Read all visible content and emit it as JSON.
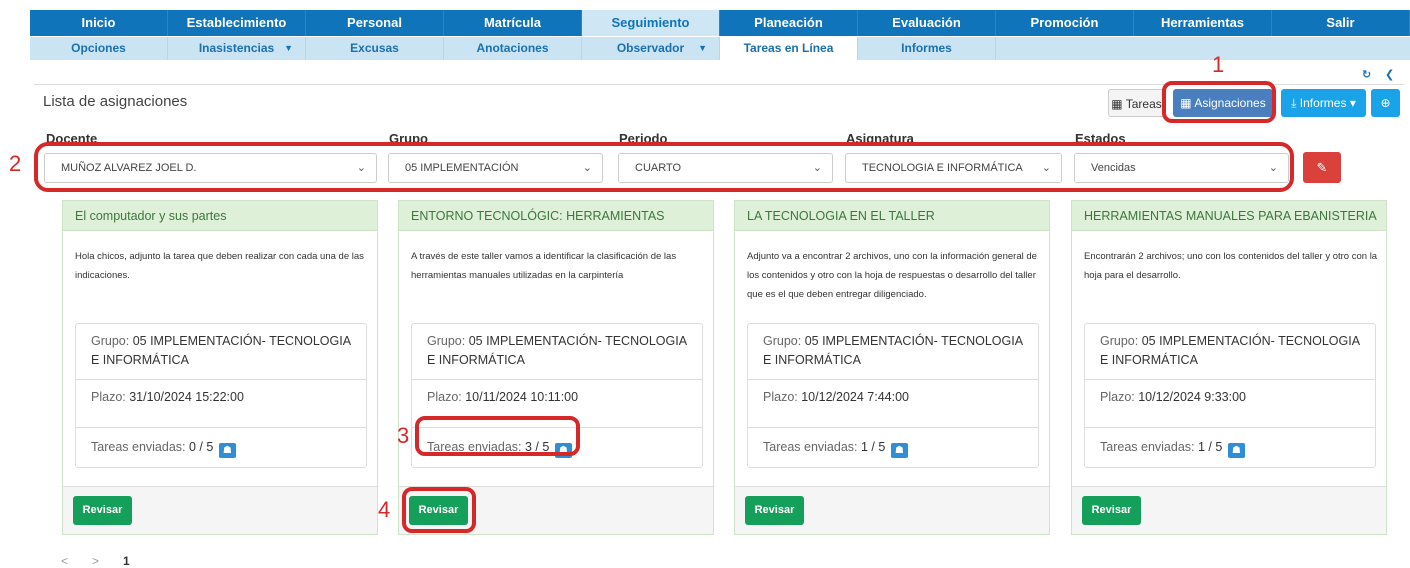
{
  "nav_main": [
    "Inicio",
    "Establecimiento",
    "Personal",
    "Matrícula",
    "Seguimiento",
    "Planeación",
    "Evaluación",
    "Promoción",
    "Herramientas",
    "Salir"
  ],
  "nav_sub": [
    {
      "label": "Opciones",
      "caret": ""
    },
    {
      "label": "Inasistencias",
      "caret": "▼"
    },
    {
      "label": "Excusas",
      "caret": ""
    },
    {
      "label": "Anotaciones",
      "caret": ""
    },
    {
      "label": "Observador",
      "caret": "▼"
    },
    {
      "label": "Tareas en Línea",
      "caret": ""
    },
    {
      "label": "Informes",
      "caret": ""
    }
  ],
  "page": {
    "title": "Lista de asignaciones"
  },
  "toolbar": {
    "tareas": "Tareas",
    "asignaciones": "Asignaciones",
    "informes": "Informes",
    "refresh_icon": "↻",
    "nav_icon": "❮"
  },
  "filters": {
    "docente_label": "Docente",
    "docente_value": "MUÑOZ ALVAREZ JOEL D.",
    "grupo_label": "Grupo",
    "grupo_value": "05 IMPLEMENTACIÓN",
    "periodo_label": "Periodo",
    "periodo_value": "CUARTO",
    "asignatura_label": "Asignatura",
    "asignatura_value": "TECNOLOGIA E INFORMÁTICA",
    "estados_label": "Estados",
    "estados_value": "Vencidas"
  },
  "cards": [
    {
      "title": "El computador y sus partes",
      "desc": "Hola chicos, adjunto la tarea que deben realizar con cada una de las indicaciones.",
      "grupo_label": "Grupo:",
      "grupo": "05 IMPLEMENTACIÓN- TECNOLOGIA E INFORMÁTICA",
      "plazo_label": "Plazo:",
      "plazo": "31/10/2024 15:22:00",
      "enviadas_label": "Tareas enviadas:",
      "enviadas": "0 / 5",
      "button": "Revisar"
    },
    {
      "title": "ENTORNO TECNOLÓGIC: HERRAMIENTAS",
      "desc": "A través de este taller vamos a identificar la clasificación de las herramientas manuales utilizadas en la carpintería",
      "grupo_label": "Grupo:",
      "grupo": "05 IMPLEMENTACIÓN- TECNOLOGIA E INFORMÁTICA",
      "plazo_label": "Plazo:",
      "plazo": "10/11/2024 10:11:00",
      "enviadas_label": "Tareas enviadas:",
      "enviadas": "3 / 5",
      "button": "Revisar"
    },
    {
      "title": "LA TECNOLOGIA EN EL TALLER",
      "desc": "Adjunto va a encontrar 2 archivos, uno con la información general de los contenidos y otro con la hoja de respuestas o desarrollo del taller que es el que deben entregar diligenciado.",
      "grupo_label": "Grupo:",
      "grupo": "05 IMPLEMENTACIÓN- TECNOLOGIA E INFORMÁTICA",
      "plazo_label": "Plazo:",
      "plazo": "10/12/2024 7:44:00",
      "enviadas_label": "Tareas enviadas:",
      "enviadas": "1 / 5",
      "button": "Revisar"
    },
    {
      "title": "HERRAMIENTAS MANUALES PARA EBANISTERIA",
      "desc": "Encontrarán 2 archivos; uno con los contenidos del taller y otro con la hoja para el desarrollo.",
      "grupo_label": "Grupo:",
      "grupo": "05 IMPLEMENTACIÓN- TECNOLOGIA E INFORMÁTICA",
      "plazo_label": "Plazo:",
      "plazo": "10/12/2024 9:33:00",
      "enviadas_label": "Tareas enviadas:",
      "enviadas": "1 / 5",
      "button": "Revisar"
    }
  ],
  "annotations": [
    "1",
    "2",
    "3",
    "4"
  ],
  "pager": {
    "prev": "<",
    "next": ">",
    "current": "1"
  },
  "colors": {
    "nav": "#0f74ba",
    "subnav": "#cbe4f4",
    "card_head": "#dff0d8",
    "revisar": "#14a05a",
    "annotation": "#d62828"
  }
}
